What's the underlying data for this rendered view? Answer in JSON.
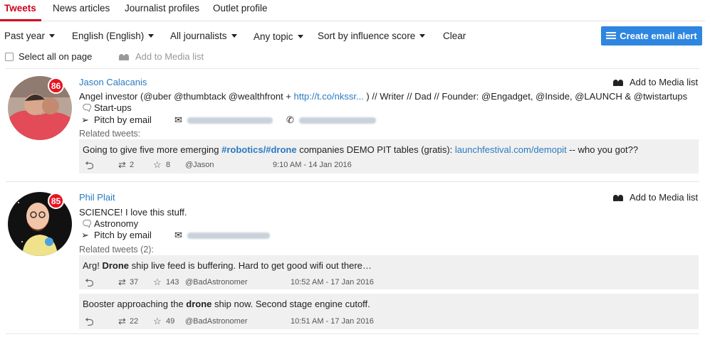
{
  "tabs": [
    {
      "label": "Tweets",
      "active": true
    },
    {
      "label": "News articles"
    },
    {
      "label": "Journalist profiles"
    },
    {
      "label": "Outlet profile"
    }
  ],
  "filters": {
    "time": "Past year",
    "language": "English (English)",
    "journalists": "All journalists",
    "topic": "Any topic",
    "sort": "Sort by influence score",
    "clear": "Clear"
  },
  "create_alert": "Create email alert",
  "select_all": "Select all on page",
  "add_to_media_list": "Add to Media list",
  "accent_color": "#d0021b",
  "button_color": "#2e86e0",
  "journalists": [
    {
      "name": "Jason Calacanis",
      "score": "86",
      "bio_prefix": "Angel investor (@uber @thumbtack @wealthfront + ",
      "bio_link": "http://t.co/nkssr...",
      "bio_suffix": " ) // Writer // Dad // Founder: @Engadget, @Inside, @LAUNCH & @twistartups",
      "topic": "Start-ups",
      "pitch": "Pitch by email",
      "related_label": "Related tweets:",
      "tweets": [
        {
          "text_a": "Going to give five more emerging ",
          "tag_a": "#robotics",
          "slash": "/",
          "tag_b": "#drone",
          "text_b": " companies DEMO PIT tables (gratis): ",
          "link": "launchfestival.com/demopit",
          "text_c": " -- who you got??",
          "retweets": "2",
          "favorites": "8",
          "handle": "@Jason",
          "time": "9:10 AM - 14 Jan 2016"
        }
      ]
    },
    {
      "name": "Phil Plait",
      "score": "85",
      "bio": "SCIENCE! I love this stuff.",
      "topic": "Astronomy",
      "pitch": "Pitch by email",
      "related_label": "Related tweets (2):",
      "tweets": [
        {
          "pre": "Arg! ",
          "bold": "Drone",
          "post": " ship live feed is buffering. Hard to get good wifi out there…",
          "retweets": "37",
          "favorites": "143",
          "handle": "@BadAstronomer",
          "time": "10:52 AM - 17 Jan 2016"
        },
        {
          "pre": "Booster approaching the ",
          "bold": "drone",
          "post": " ship now. Second stage engine cutoff.",
          "retweets": "22",
          "favorites": "49",
          "handle": "@BadAstronomer",
          "time": "10:51 AM - 17 Jan 2016"
        }
      ]
    }
  ]
}
